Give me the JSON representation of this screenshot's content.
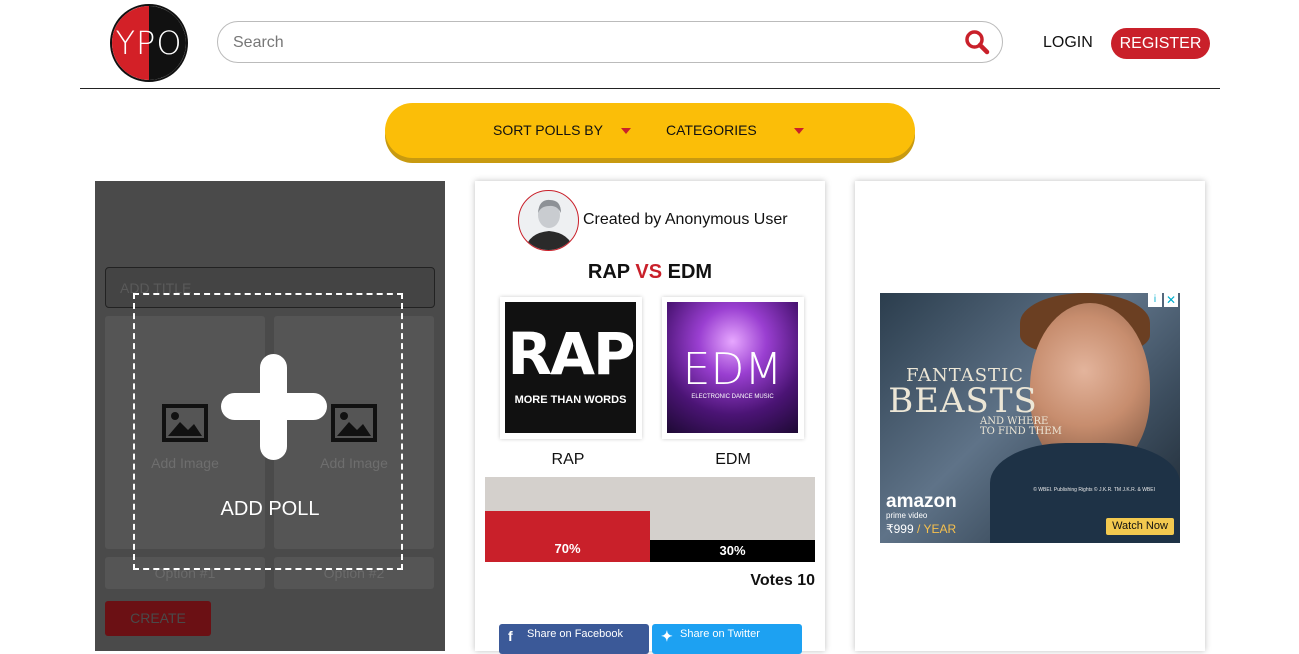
{
  "header": {
    "logo_text": "YPO",
    "search_placeholder": "Search",
    "login_label": "LOGIN",
    "register_label": "REGISTER"
  },
  "filters": {
    "sort_label": "SORT POLLS BY",
    "categories_label": "CATEGORIES"
  },
  "create_poll": {
    "title_placeholder": "ADD TITLE",
    "add_image_1": "Add Image",
    "add_image_2": "Add Image",
    "option_1": "Option #1",
    "option_2": "Option #2",
    "create_label": "CREATE",
    "add_poll_label": "ADD POLL"
  },
  "poll": {
    "created_by": "Created by Anonymous User",
    "title_a": "RAP",
    "title_vs": "VS",
    "title_b": "EDM",
    "option_a_image_text": "RAP",
    "option_a_image_subtext": "MORE THAN WORDS",
    "option_b_image_text": "EDM",
    "option_b_image_subtext": "ELECTRONIC DANCE MUSIC",
    "option_a": "RAP",
    "option_b": "EDM",
    "option_a_percent_label": "70%",
    "option_b_percent_label": "30%",
    "option_a_percent": 70,
    "option_b_percent": 30,
    "votes_label": "Votes 10",
    "share_facebook": "Share on Facebook",
    "share_twitter": "Share on Twitter"
  },
  "ad": {
    "title_line1": "FANTASTIC",
    "title_line2": "BEASTS",
    "title_line3a": "AND WHERE",
    "title_line3b": "TO FIND THEM",
    "brand": "amazon",
    "brand_sub": "prime video",
    "price": "₹999",
    "price_period": " / YEAR",
    "legal": "© WBEI. Publishing Rights © J.K.R. TM J.K.R. & WBEI",
    "cta": "Watch Now"
  },
  "colors": {
    "brand_red": "#c9202a",
    "filter_yellow": "#fbbe08"
  }
}
